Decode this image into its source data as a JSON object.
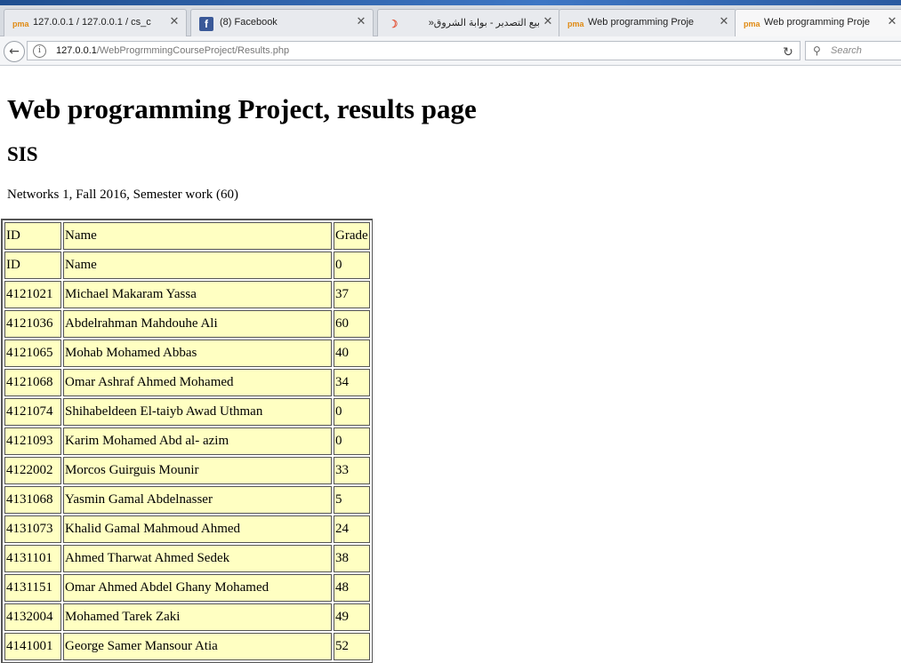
{
  "tabs": [
    {
      "title": "127.0.0.1 / 127.0.0.1 / cs_c",
      "favicon": "phpmyadmin-icon",
      "rtl": false
    },
    {
      "title": "(8) Facebook",
      "favicon": "facebook-icon",
      "rtl": false
    },
    {
      "title": "بيع التصدير - بوابة الشروق«",
      "favicon": "shorouk-icon",
      "rtl": true
    },
    {
      "title": "Web programming Proje",
      "favicon": "phpmyadmin-icon",
      "rtl": false
    },
    {
      "title": "Web programming Proje",
      "favicon": "phpmyadmin-icon",
      "rtl": false,
      "active": true
    }
  ],
  "address_bar": {
    "host": "127.0.0.1",
    "path": "/WebProgrmmingCourseProject/Results.php"
  },
  "search": {
    "placeholder": "Search"
  },
  "page": {
    "title": "Web programming Project, results page",
    "subtitle": "SIS",
    "course_info": "Networks 1, Fall 2016, Semester work (60)"
  },
  "table": {
    "headers": [
      "ID",
      "Name",
      "Grade"
    ],
    "rows": [
      [
        "ID",
        "Name",
        "0"
      ],
      [
        "4121021",
        "Michael Makaram Yassa",
        "37"
      ],
      [
        "4121036",
        "Abdelrahman Mahdouhe Ali",
        "60"
      ],
      [
        "4121065",
        "Mohab Mohamed Abbas",
        "40"
      ],
      [
        "4121068",
        "Omar Ashraf Ahmed Mohamed",
        "34"
      ],
      [
        "4121074",
        "Shihabeldeen El-taiyb Awad Uthman",
        "0"
      ],
      [
        "4121093",
        "Karim Mohamed Abd al- azim",
        "0"
      ],
      [
        "4122002",
        "Morcos Guirguis Mounir",
        "33"
      ],
      [
        "4131068",
        "Yasmin Gamal Abdelnasser",
        "5"
      ],
      [
        "4131073",
        "Khalid Gamal Mahmoud Ahmed",
        "24"
      ],
      [
        "4131101",
        "Ahmed Tharwat Ahmed Sedek",
        "38"
      ],
      [
        "4131151",
        "Omar Ahmed Abdel Ghany Mohamed",
        "48"
      ],
      [
        "4132004",
        "Mohamed Tarek Zaki",
        "49"
      ],
      [
        "4141001",
        "George Samer Mansour Atia",
        "52"
      ]
    ]
  },
  "colors": {
    "table_cell_bg": "#ffffc2",
    "facebook_blue": "#3b5998",
    "pma_orange": "#e08a12"
  }
}
